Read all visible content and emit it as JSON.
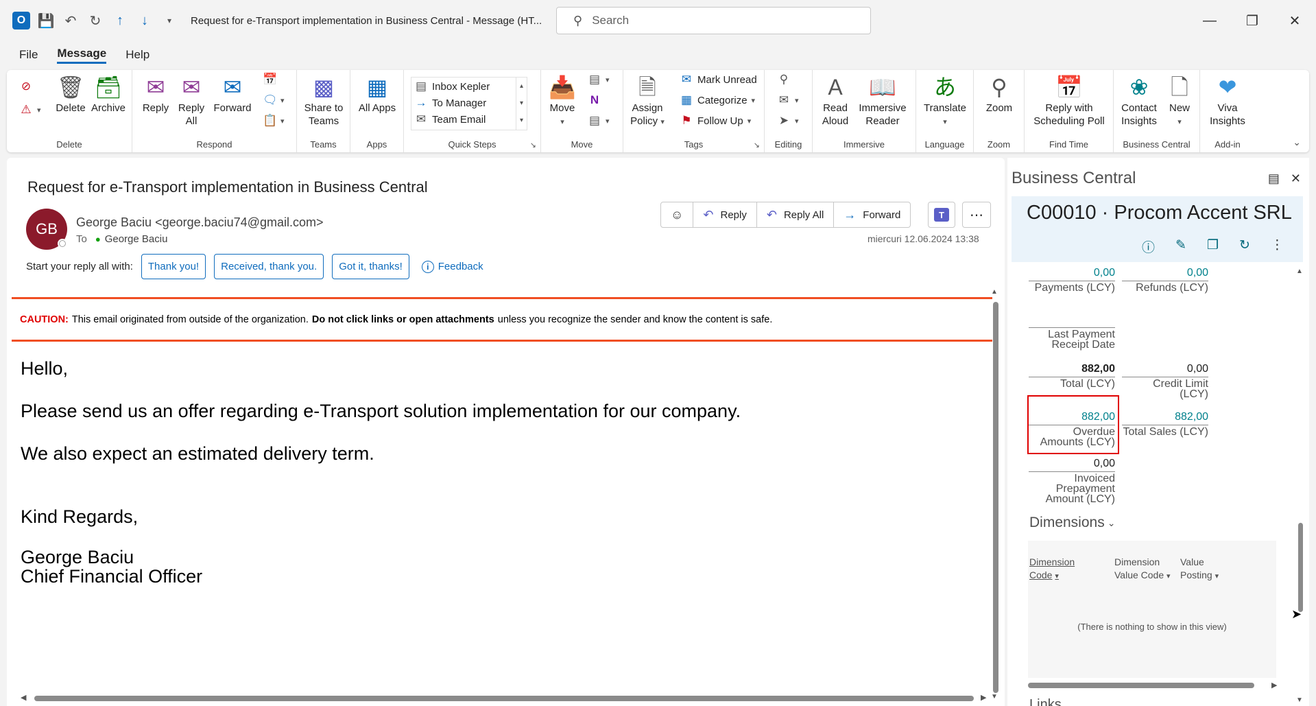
{
  "window": {
    "title": "Request for e-Transport implementation in Business Central  -  Message (HT...",
    "search_placeholder": "Search"
  },
  "menu": {
    "tabs": [
      "File",
      "Message",
      "Help"
    ]
  },
  "ribbon": {
    "groups": {
      "delete": {
        "label": "Delete",
        "delete_btn": "Delete",
        "archive_btn": "Archive"
      },
      "respond": {
        "label": "Respond",
        "reply": "Reply",
        "reply_all": "Reply All",
        "forward": "Forward"
      },
      "teams": {
        "label": "Teams",
        "share": "Share to Teams"
      },
      "apps": {
        "label": "Apps",
        "all_apps": "All Apps"
      },
      "quick_steps": {
        "label": "Quick Steps",
        "items": [
          "Inbox Kepler",
          "To Manager",
          "Team Email"
        ]
      },
      "move": {
        "label": "Move",
        "move_btn": "Move"
      },
      "tags": {
        "label": "Tags",
        "assign_policy": "Assign Policy",
        "mark_unread": "Mark Unread",
        "categorize": "Categorize",
        "follow_up": "Follow Up"
      },
      "editing": {
        "label": "Editing"
      },
      "immersive": {
        "label": "Immersive",
        "read_aloud": "Read Aloud",
        "immersive_reader": "Immersive Reader"
      },
      "language": {
        "label": "Language",
        "translate": "Translate"
      },
      "zoom": {
        "label": "Zoom",
        "zoom_btn": "Zoom"
      },
      "find_time": {
        "label": "Find Time",
        "reply_poll": "Reply with Scheduling Poll"
      },
      "business_central": {
        "label": "Business Central",
        "contact_insights": "Contact Insights",
        "new": "New"
      },
      "add_in": {
        "label": "Add-in",
        "viva": "Viva Insights"
      }
    }
  },
  "message": {
    "subject": "Request for e-Transport implementation in Business Central",
    "avatar_initials": "GB",
    "sender": "George Baciu <george.baciu74@gmail.com>",
    "to_label": "To",
    "to_name": "George Baciu",
    "date": "miercuri 12.06.2024 13:38",
    "actions": {
      "reply": "Reply",
      "reply_all": "Reply All",
      "forward": "Forward"
    },
    "quick_reply_prompt": "Start your reply all with:",
    "quick_replies": [
      "Thank you!",
      "Received, thank you.",
      "Got it, thanks!"
    ],
    "feedback": "Feedback",
    "caution": {
      "label": "CAUTION:",
      "text1": "This email originated from outside of the organization.",
      "bold": "Do not click links or open attachments",
      "text2": "unless you recognize the sender and know the content is safe."
    },
    "body": {
      "greeting": "Hello,",
      "line1": "Please send us an offer regarding e-Transport solution implementation for our company.",
      "line2": "We also expect an estimated delivery term.",
      "closing": "Kind Regards,",
      "sig_name": "George Baciu",
      "sig_title": "Chief Financial Officer"
    }
  },
  "bc": {
    "pane_title": "Business Central",
    "card_title": "C00010 · Procom Accent SRL",
    "fields": {
      "payments": {
        "value": "0,00",
        "label": "Payments (LCY)"
      },
      "refunds": {
        "value": "0,00",
        "label": "Refunds (LCY)"
      },
      "last_payment": {
        "value": "",
        "label": "Last Payment Receipt Date"
      },
      "total": {
        "value": "882,00",
        "label": "Total (LCY)"
      },
      "credit_limit": {
        "value": "0,00",
        "label": "Credit Limit (LCY)"
      },
      "overdue": {
        "value": "882,00",
        "label": "Overdue Amounts (LCY)"
      },
      "total_sales": {
        "value": "882,00",
        "label": "Total Sales (LCY)"
      },
      "invoiced_prepayment": {
        "value": "0,00",
        "label": "Invoiced Prepayment Amount (LCY)"
      }
    },
    "dimensions": {
      "title": "Dimensions",
      "col1": [
        "Dimension",
        "Code"
      ],
      "col2": [
        "Dimension",
        "Value Code"
      ],
      "col3": [
        "Value",
        "Posting"
      ],
      "empty": "(There is nothing to show in this view)"
    },
    "links_title": "Links"
  },
  "colors": {
    "accent": "#0f6cbd",
    "bc_teal": "#00818c",
    "caution_red": "#e00000",
    "caution_border": "#f04e23",
    "avatar_bg": "#8b1a2b"
  }
}
